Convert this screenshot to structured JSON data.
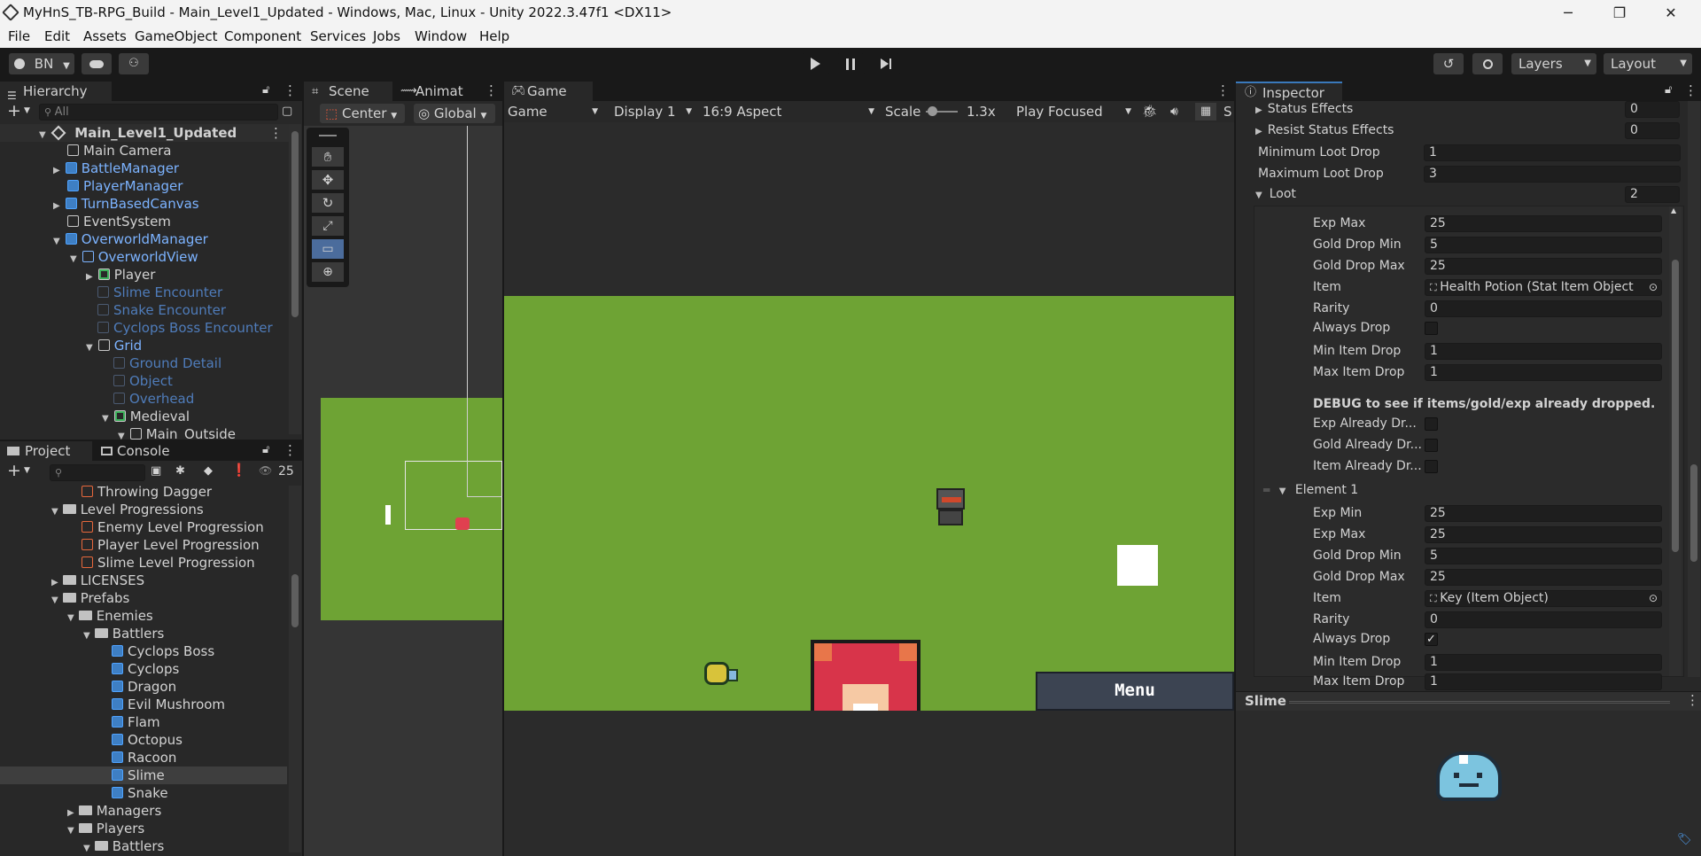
{
  "window": {
    "title": "MyHnS_TB-RPG_Build - Main_Level1_Updated - Windows, Mac, Linux - Unity 2022.3.47f1 <DX11>",
    "minimize": "─",
    "restore": "❐",
    "close": "✕"
  },
  "menu": [
    "File",
    "Edit",
    "Assets",
    "GameObject",
    "Component",
    "Services",
    "Jobs",
    "Window",
    "Help"
  ],
  "toolbar": {
    "account": "BN",
    "layers": "Layers",
    "layout": "Layout"
  },
  "hierarchy": {
    "tab": "Hierarchy",
    "search_placeholder": "All",
    "scene": "Main_Level1_Updated",
    "items": [
      {
        "label": "Main Camera"
      },
      {
        "label": "BattleManager"
      },
      {
        "label": "PlayerManager"
      },
      {
        "label": "TurnBasedCanvas"
      },
      {
        "label": "EventSystem"
      },
      {
        "label": "OverworldManager"
      },
      {
        "label": "OverworldView"
      },
      {
        "label": "Player"
      },
      {
        "label": "Slime Encounter"
      },
      {
        "label": "Snake Encounter"
      },
      {
        "label": "Cyclops Boss Encounter"
      },
      {
        "label": "Grid"
      },
      {
        "label": "Ground Detail"
      },
      {
        "label": "Object"
      },
      {
        "label": "Overhead"
      },
      {
        "label": "Medieval"
      },
      {
        "label": "Main_Outside"
      }
    ]
  },
  "project": {
    "tab_project": "Project",
    "tab_console": "Console",
    "hidden_count": "25",
    "items": [
      {
        "label": "Throwing Dagger"
      },
      {
        "label": "Level Progressions"
      },
      {
        "label": "Enemy Level Progression"
      },
      {
        "label": "Player Level Progression"
      },
      {
        "label": "Slime Level Progression"
      },
      {
        "label": "LICENSES"
      },
      {
        "label": "Prefabs"
      },
      {
        "label": "Enemies"
      },
      {
        "label": "Battlers"
      },
      {
        "label": "Cyclops Boss"
      },
      {
        "label": "Cyclops"
      },
      {
        "label": "Dragon"
      },
      {
        "label": "Evil Mushroom"
      },
      {
        "label": "Flam"
      },
      {
        "label": "Octopus"
      },
      {
        "label": "Racoon"
      },
      {
        "label": "Slime"
      },
      {
        "label": "Snake"
      },
      {
        "label": "Managers"
      },
      {
        "label": "Players"
      },
      {
        "label": "Battlers"
      }
    ]
  },
  "scene_view": {
    "tab_scene": "Scene",
    "tab_animator": "Animat",
    "pivot": "Center",
    "space": "Global"
  },
  "game_view": {
    "tab": "Game",
    "mode": "Game",
    "display": "Display 1",
    "aspect": "16:9 Aspect",
    "scale_label": "Scale",
    "scale_value": "1.3x",
    "play_mode": "Play Focused",
    "stats_cut": "S",
    "menu_button": "Menu",
    "colors": {
      "grass": "#6ea334",
      "dark": "#2b2b2b"
    }
  },
  "inspector": {
    "tab": "Inspector",
    "status_effects_label": "Status Effects",
    "status_effects_value": "0",
    "resist_label": "Resist Status Effects",
    "resist_value": "0",
    "min_loot_label": "Minimum Loot Drop",
    "min_loot_value": "1",
    "max_loot_label": "Maximum Loot Drop",
    "max_loot_value": "3",
    "loot_label": "Loot",
    "loot_count": "2",
    "e0": {
      "exp_max_label": "Exp Max",
      "exp_max": "25",
      "gold_min_label": "Gold Drop Min",
      "gold_min": "5",
      "gold_max_label": "Gold Drop Max",
      "gold_max": "25",
      "item_label": "Item",
      "item": "Health Potion (Stat Item Object",
      "rarity_label": "Rarity",
      "rarity": "0",
      "always_label": "Always Drop",
      "always": false,
      "min_item_label": "Min Item Drop",
      "min_item": "1",
      "max_item_label": "Max Item Drop",
      "max_item": "1"
    },
    "debug_header": "DEBUG to see if items/gold/exp already dropped.",
    "debug_exp": "Exp Already Dr...",
    "debug_gold": "Gold Already Dr...",
    "debug_item": "Item Already Dr...",
    "e1": {
      "header": "Element 1",
      "exp_min_label": "Exp Min",
      "exp_min": "25",
      "exp_max_label": "Exp Max",
      "exp_max": "25",
      "gold_min_label": "Gold Drop Min",
      "gold_min": "5",
      "gold_max_label": "Gold Drop Max",
      "gold_max": "25",
      "item_label": "Item",
      "item": "Key (Item Object)",
      "rarity_label": "Rarity",
      "rarity": "0",
      "always_label": "Always Drop",
      "always": true,
      "min_item_label": "Min Item Drop",
      "min_item": "1",
      "max_item_label": "Max Item Drop",
      "max_item": "1"
    },
    "preview_title": "Slime"
  }
}
